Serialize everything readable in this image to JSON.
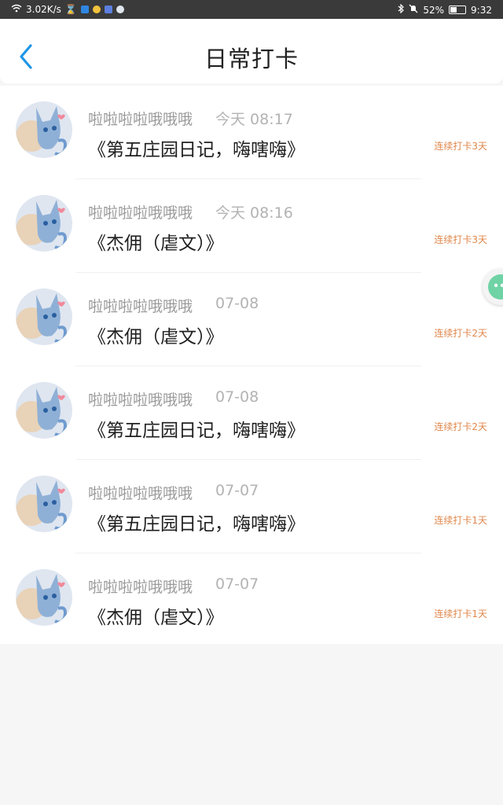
{
  "status_bar": {
    "network_speed": "3.02K/s",
    "battery": "52%",
    "battery_level": 0.52,
    "time": "9:32"
  },
  "header": {
    "title": "日常打卡"
  },
  "entries": [
    {
      "username": "啦啦啦啦哦哦哦",
      "time": "今天 08:17",
      "book": "《第五庄园日记，嗨嗐嗨》",
      "streak": "连续打卡3天"
    },
    {
      "username": "啦啦啦啦哦哦哦",
      "time": "今天 08:16",
      "book": "《杰佣（虐文）》",
      "streak": "连续打卡3天"
    },
    {
      "username": "啦啦啦啦哦哦哦",
      "time": "07-08",
      "book": "《杰佣（虐文）》",
      "streak": "连续打卡2天"
    },
    {
      "username": "啦啦啦啦哦哦哦",
      "time": "07-08",
      "book": "《第五庄园日记，嗨嗐嗨》",
      "streak": "连续打卡2天"
    },
    {
      "username": "啦啦啦啦哦哦哦",
      "time": "07-07",
      "book": "《第五庄园日记，嗨嗐嗨》",
      "streak": "连续打卡1天"
    },
    {
      "username": "啦啦啦啦哦哦哦",
      "time": "07-07",
      "book": "《杰佣（虐文）》",
      "streak": "连续打卡1天"
    }
  ],
  "colors": {
    "accent": "#1e96e6",
    "streak": "#e0874b",
    "floating_icon": "#6fd3a5"
  }
}
